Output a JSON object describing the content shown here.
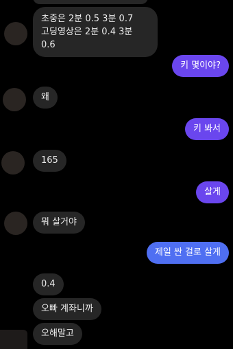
{
  "messages": {
    "m1_line1": "초중은 2분 0.5 3분 0.7",
    "m1_line2": "고딩영상은 2분 0.4 3분 0.6",
    "m2": "키 몇이야?",
    "m3": "왜",
    "m4": "키 봐서",
    "m5": "165",
    "m6": "살게",
    "m7": "뭐 살거야",
    "m8": "제일 싼 걸로 살게",
    "m9": "0.4",
    "m10": "오빠 계좌니까",
    "m11": "오해말고"
  },
  "colors": {
    "background": "#000000",
    "incoming_bubble": "#262626",
    "outgoing_bubble_blue": "#4f6ff2",
    "outgoing_bubble_violet": "#6a46ee"
  }
}
